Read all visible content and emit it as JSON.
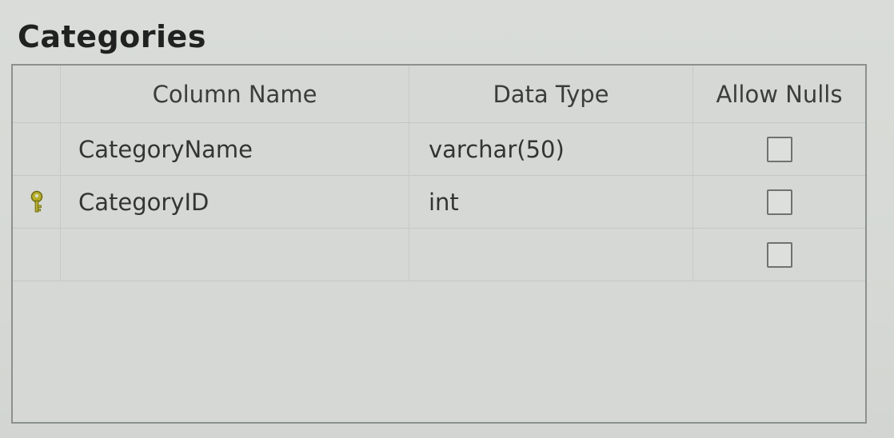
{
  "table": {
    "title": "Categories",
    "columns": {
      "name": "Column Name",
      "type": "Data Type",
      "nulls": "Allow Nulls"
    },
    "rows": [
      {
        "name": "CategoryName",
        "type": "varchar(50)",
        "allow_nulls": false,
        "primary_key": false
      },
      {
        "name": "CategoryID",
        "type": "int",
        "allow_nulls": false,
        "primary_key": true
      },
      {
        "name": "",
        "type": "",
        "allow_nulls": false,
        "primary_key": false
      }
    ]
  },
  "icons": {
    "primary_key": "key-icon"
  },
  "colors": {
    "key_icon": "#b8b020"
  }
}
